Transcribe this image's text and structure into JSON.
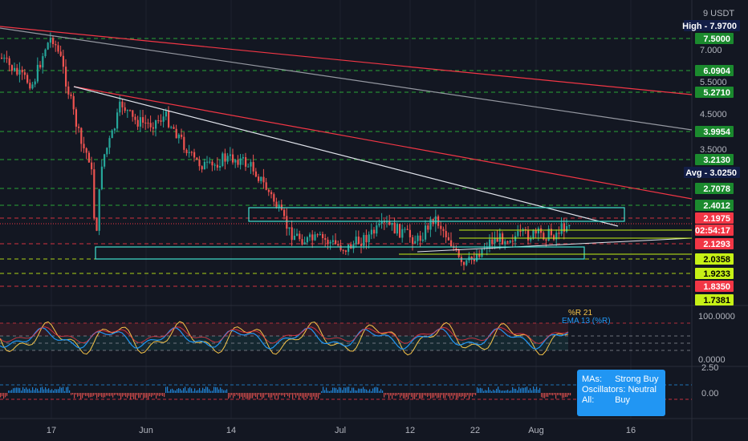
{
  "chart_data": {
    "type": "line",
    "symbol_currency": "USDT",
    "price_axis_top_label": "9",
    "price_ticks": [
      "7.000",
      "5.5000",
      "4.5000",
      "3.5000"
    ],
    "date_ticks": [
      "17",
      "Jun",
      "14",
      "Jul",
      "12",
      "22",
      "Aug",
      "16"
    ],
    "series": [],
    "levels": [
      {
        "label": "High",
        "value": "7.9700",
        "color": "#131e47",
        "text": "#ffffff"
      },
      {
        "value": "7.5000",
        "color": "#1b8a2e",
        "text": "#ffffff"
      },
      {
        "value": "6.0904",
        "color": "#1b8a2e",
        "text": "#ffffff"
      },
      {
        "value": "5.2710",
        "color": "#1b8a2e",
        "text": "#ffffff"
      },
      {
        "value": "3.9954",
        "color": "#1b8a2e",
        "text": "#ffffff"
      },
      {
        "value": "3.2130",
        "color": "#1b8a2e",
        "text": "#ffffff"
      },
      {
        "label": "Avg",
        "value": "3.0250",
        "color": "#131e47",
        "text": "#ffffff"
      },
      {
        "value": "2.7078",
        "color": "#1b8a2e",
        "text": "#ffffff"
      },
      {
        "value": "2.4012",
        "color": "#1b8a2e",
        "text": "#ffffff"
      },
      {
        "value": "2.1975",
        "color": "#f23645",
        "text": "#ffffff"
      },
      {
        "value": "02:54:17",
        "color": "#f23645",
        "text": "#ffffff"
      },
      {
        "value": "2.1293",
        "color": "#f23645",
        "text": "#ffffff"
      },
      {
        "value": "2.0358",
        "color": "#c6f116",
        "text": "#000000"
      },
      {
        "value": "1.9233",
        "color": "#c6f116",
        "text": "#000000"
      },
      {
        "value": "1.8350",
        "color": "#f23645",
        "text": "#ffffff"
      },
      {
        "value": "1.7381",
        "color": "#c6f116",
        "text": "#000000"
      }
    ],
    "oscillator": {
      "axis_labels": [
        "100.0000",
        "0.0000"
      ],
      "legend": [
        "%R 21",
        "EMA 13 (%R)"
      ],
      "colors": {
        "fast": "#f7c548",
        "slow": "#2196f3",
        "mid": "#f23645"
      }
    },
    "histogram": {
      "axis_labels": [
        "2.50",
        "0.00"
      ]
    },
    "colors": {
      "background": "#131722",
      "up": "#26a69a",
      "down": "#ef5350",
      "trend_red": "#f23645",
      "trend_grey": "#9598a1",
      "trend_white": "#e0e3eb",
      "box_cyan": "#40e0d0",
      "green_dash": "#2ebd3a",
      "red_dash": "#f23645"
    }
  },
  "technical_summary": {
    "mas_label": "MAs:",
    "mas_value": "Strong Buy",
    "osc_label": "Oscillators:",
    "osc_value": "Neutral",
    "all_label": "All:",
    "all_value": "Buy"
  }
}
